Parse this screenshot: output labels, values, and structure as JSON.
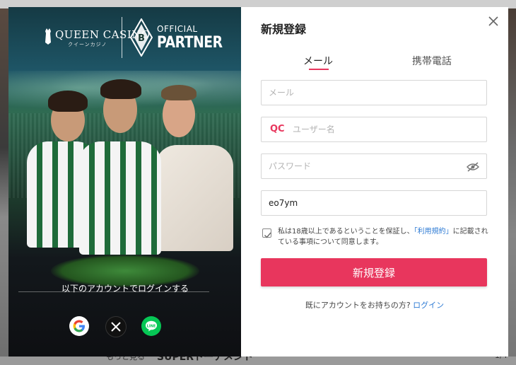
{
  "background": {
    "bottom_left_text": "もっと見る",
    "bottom_heading": "SUPERトーナメント",
    "bottom_page": "1/4"
  },
  "promo": {
    "brand_name": "QUEEN CASINO",
    "brand_sub": "クイーンカジノ",
    "partner_line1": "OFFICIAL",
    "partner_line2": "PARTNER",
    "login_with": "以下のアカウントでログインする",
    "social": [
      "google-icon",
      "x-icon",
      "line-icon"
    ]
  },
  "form": {
    "title": "新規登録",
    "tabs": [
      {
        "label": "メール",
        "active": true
      },
      {
        "label": "携帯電話",
        "active": false
      }
    ],
    "email_placeholder": "メール",
    "username_prefix": "QC",
    "username_placeholder": "ユーザー名",
    "password_placeholder": "パスワード",
    "promo_code_value": "eo7ym",
    "consent_before": "私は18歳以上であるということを保証し、",
    "consent_link": "「利用規約」",
    "consent_after": "に記載されている事項について同意します。",
    "submit_label": "新規登録",
    "login_prompt": "既にアカウントをお持ちの方?",
    "login_link": "ログイン"
  },
  "colors": {
    "accent": "#e8365d",
    "link": "#2e7bd4"
  }
}
